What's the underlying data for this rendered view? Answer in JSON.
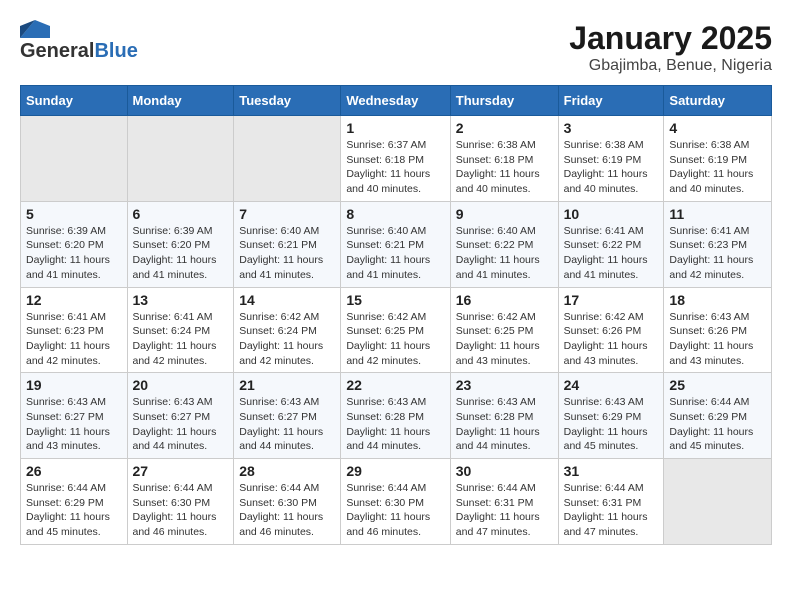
{
  "logo": {
    "general": "General",
    "blue": "Blue"
  },
  "title": "January 2025",
  "location": "Gbajimba, Benue, Nigeria",
  "days_of_week": [
    "Sunday",
    "Monday",
    "Tuesday",
    "Wednesday",
    "Thursday",
    "Friday",
    "Saturday"
  ],
  "weeks": [
    [
      {
        "day": "",
        "info": ""
      },
      {
        "day": "",
        "info": ""
      },
      {
        "day": "",
        "info": ""
      },
      {
        "day": "1",
        "info": "Sunrise: 6:37 AM\nSunset: 6:18 PM\nDaylight: 11 hours\nand 40 minutes."
      },
      {
        "day": "2",
        "info": "Sunrise: 6:38 AM\nSunset: 6:18 PM\nDaylight: 11 hours\nand 40 minutes."
      },
      {
        "day": "3",
        "info": "Sunrise: 6:38 AM\nSunset: 6:19 PM\nDaylight: 11 hours\nand 40 minutes."
      },
      {
        "day": "4",
        "info": "Sunrise: 6:38 AM\nSunset: 6:19 PM\nDaylight: 11 hours\nand 40 minutes."
      }
    ],
    [
      {
        "day": "5",
        "info": "Sunrise: 6:39 AM\nSunset: 6:20 PM\nDaylight: 11 hours\nand 41 minutes."
      },
      {
        "day": "6",
        "info": "Sunrise: 6:39 AM\nSunset: 6:20 PM\nDaylight: 11 hours\nand 41 minutes."
      },
      {
        "day": "7",
        "info": "Sunrise: 6:40 AM\nSunset: 6:21 PM\nDaylight: 11 hours\nand 41 minutes."
      },
      {
        "day": "8",
        "info": "Sunrise: 6:40 AM\nSunset: 6:21 PM\nDaylight: 11 hours\nand 41 minutes."
      },
      {
        "day": "9",
        "info": "Sunrise: 6:40 AM\nSunset: 6:22 PM\nDaylight: 11 hours\nand 41 minutes."
      },
      {
        "day": "10",
        "info": "Sunrise: 6:41 AM\nSunset: 6:22 PM\nDaylight: 11 hours\nand 41 minutes."
      },
      {
        "day": "11",
        "info": "Sunrise: 6:41 AM\nSunset: 6:23 PM\nDaylight: 11 hours\nand 42 minutes."
      }
    ],
    [
      {
        "day": "12",
        "info": "Sunrise: 6:41 AM\nSunset: 6:23 PM\nDaylight: 11 hours\nand 42 minutes."
      },
      {
        "day": "13",
        "info": "Sunrise: 6:41 AM\nSunset: 6:24 PM\nDaylight: 11 hours\nand 42 minutes."
      },
      {
        "day": "14",
        "info": "Sunrise: 6:42 AM\nSunset: 6:24 PM\nDaylight: 11 hours\nand 42 minutes."
      },
      {
        "day": "15",
        "info": "Sunrise: 6:42 AM\nSunset: 6:25 PM\nDaylight: 11 hours\nand 42 minutes."
      },
      {
        "day": "16",
        "info": "Sunrise: 6:42 AM\nSunset: 6:25 PM\nDaylight: 11 hours\nand 43 minutes."
      },
      {
        "day": "17",
        "info": "Sunrise: 6:42 AM\nSunset: 6:26 PM\nDaylight: 11 hours\nand 43 minutes."
      },
      {
        "day": "18",
        "info": "Sunrise: 6:43 AM\nSunset: 6:26 PM\nDaylight: 11 hours\nand 43 minutes."
      }
    ],
    [
      {
        "day": "19",
        "info": "Sunrise: 6:43 AM\nSunset: 6:27 PM\nDaylight: 11 hours\nand 43 minutes."
      },
      {
        "day": "20",
        "info": "Sunrise: 6:43 AM\nSunset: 6:27 PM\nDaylight: 11 hours\nand 44 minutes."
      },
      {
        "day": "21",
        "info": "Sunrise: 6:43 AM\nSunset: 6:27 PM\nDaylight: 11 hours\nand 44 minutes."
      },
      {
        "day": "22",
        "info": "Sunrise: 6:43 AM\nSunset: 6:28 PM\nDaylight: 11 hours\nand 44 minutes."
      },
      {
        "day": "23",
        "info": "Sunrise: 6:43 AM\nSunset: 6:28 PM\nDaylight: 11 hours\nand 44 minutes."
      },
      {
        "day": "24",
        "info": "Sunrise: 6:43 AM\nSunset: 6:29 PM\nDaylight: 11 hours\nand 45 minutes."
      },
      {
        "day": "25",
        "info": "Sunrise: 6:44 AM\nSunset: 6:29 PM\nDaylight: 11 hours\nand 45 minutes."
      }
    ],
    [
      {
        "day": "26",
        "info": "Sunrise: 6:44 AM\nSunset: 6:29 PM\nDaylight: 11 hours\nand 45 minutes."
      },
      {
        "day": "27",
        "info": "Sunrise: 6:44 AM\nSunset: 6:30 PM\nDaylight: 11 hours\nand 46 minutes."
      },
      {
        "day": "28",
        "info": "Sunrise: 6:44 AM\nSunset: 6:30 PM\nDaylight: 11 hours\nand 46 minutes."
      },
      {
        "day": "29",
        "info": "Sunrise: 6:44 AM\nSunset: 6:30 PM\nDaylight: 11 hours\nand 46 minutes."
      },
      {
        "day": "30",
        "info": "Sunrise: 6:44 AM\nSunset: 6:31 PM\nDaylight: 11 hours\nand 47 minutes."
      },
      {
        "day": "31",
        "info": "Sunrise: 6:44 AM\nSunset: 6:31 PM\nDaylight: 11 hours\nand 47 minutes."
      },
      {
        "day": "",
        "info": ""
      }
    ]
  ]
}
